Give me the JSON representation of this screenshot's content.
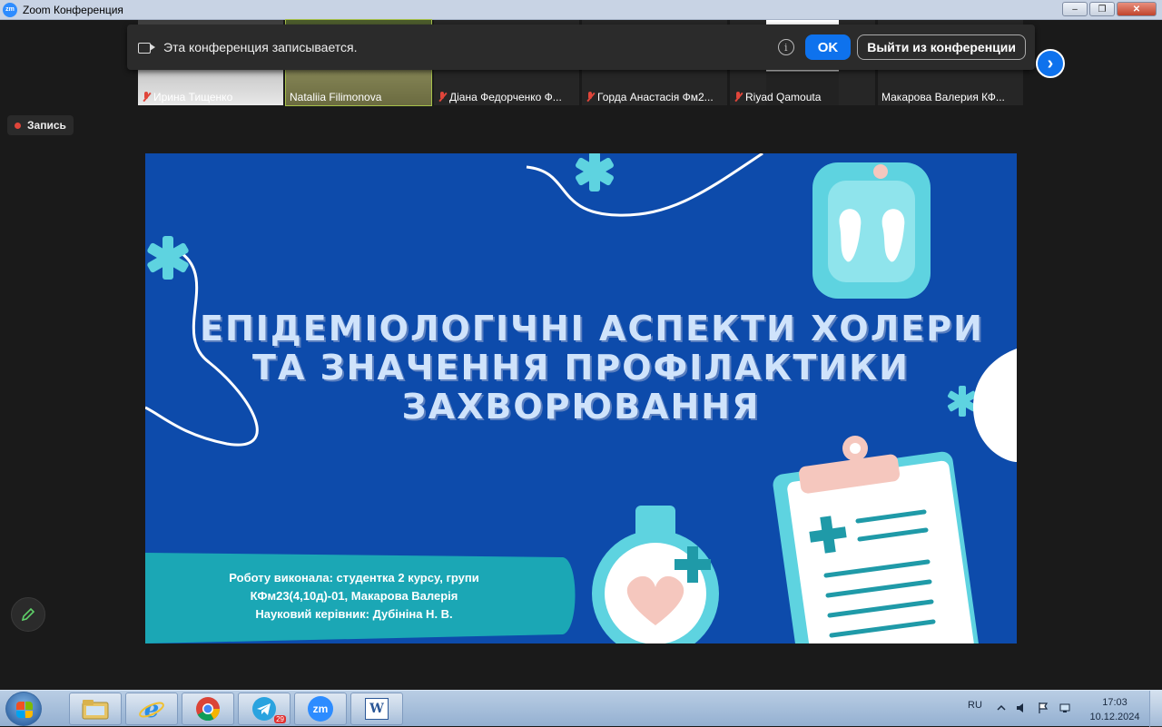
{
  "window": {
    "title": "Zoom Конференция",
    "logo_text": "zm",
    "minimize": "–",
    "maximize": "❐",
    "close": "✕"
  },
  "participants": [
    {
      "name": "Ирина Тищенко",
      "muted": true
    },
    {
      "name": "Nataliia Filimonova",
      "muted": false,
      "active": true
    },
    {
      "name": "Діана Федорченко Ф...",
      "muted": true
    },
    {
      "name": "Горда Анастасія Фм2...",
      "muted": true
    },
    {
      "name": "Riyad Qamouta",
      "muted": true
    },
    {
      "name": "Макарова Валерия КФ...",
      "muted": false
    }
  ],
  "recording_banner": {
    "message": "Эта конференция записывается.",
    "info_icon": "i",
    "ok_label": "OK",
    "leave_label": "Выйти из конференции"
  },
  "next_page_arrow": "›",
  "recording_badge": "Запись",
  "slide": {
    "title_lines": [
      "ЕПІДЕМІОЛОГІЧНІ АСПЕКТИ ХОЛЕРИ",
      "ТА ЗНАЧЕННЯ ПРОФІЛАКТИКИ",
      "ЗАХВОРЮВАННЯ"
    ],
    "author_lines": [
      "Роботу виконала: студентка 2 курсу, групи",
      "КФм23(4,10д)-01, Макарова Валерія",
      "Науковий керівник: Дубініна Н. В."
    ]
  },
  "taskbar": {
    "apps": [
      "windows-explorer",
      "internet-explorer",
      "chrome",
      "telegram",
      "zoom",
      "word"
    ],
    "telegram_badge": "29",
    "zoom_label": "zm",
    "word_label": "W",
    "language": "RU",
    "time": "17:03",
    "date": "10.12.2024"
  },
  "colors": {
    "slide_bg": "#0d4bab",
    "zoom_blue": "#0e72ed",
    "accent_teal": "#5ed3e0",
    "accent_pink": "#f5c7be"
  }
}
